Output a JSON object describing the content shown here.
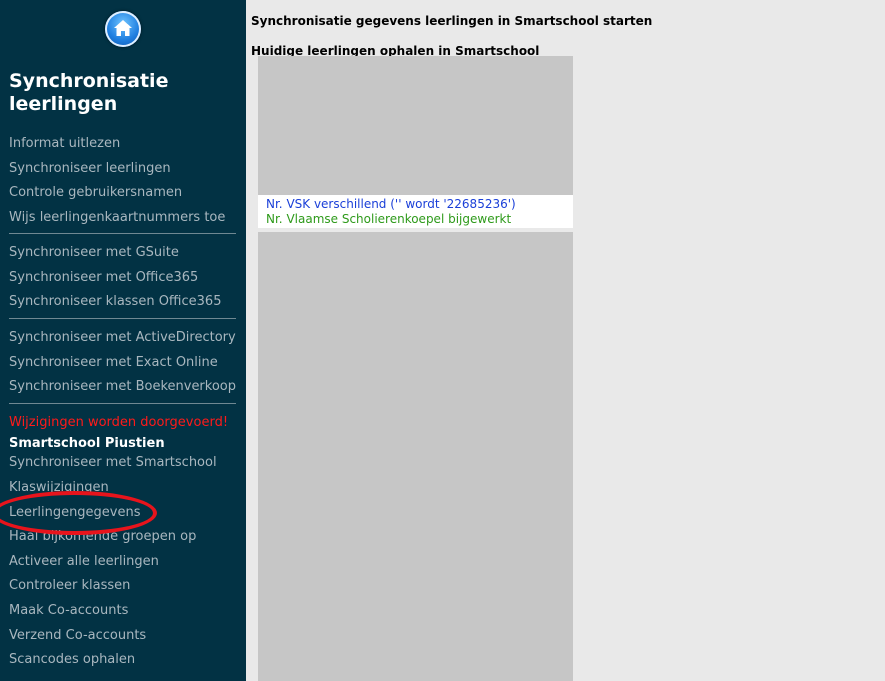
{
  "sidebar": {
    "title": "Synchronisatie leerlingen",
    "home_icon": "home-icon",
    "group1": [
      "Informat uitlezen",
      "Synchroniseer leerlingen",
      "Controle gebruikersnamen",
      "Wijs leerlingenkaartnummers toe"
    ],
    "group2": [
      "Synchroniseer met GSuite",
      "Synchroniseer met Office365",
      "Synchroniseer klassen Office365"
    ],
    "group3": [
      "Synchroniseer met ActiveDirectory",
      "Synchroniseer met Exact Online",
      "Synchroniseer met Boekenverkoop"
    ],
    "warning": "Wijzigingen worden doorgevoerd!",
    "section_heading": "Smartschool Piustien",
    "group4": [
      "Synchroniseer met Smartschool",
      "Klaswijzigingen",
      "Leerlingengegevens",
      "Haal bijkomende groepen op",
      "Activeer alle leerlingen",
      "Controleer klassen",
      "Maak Co-accounts",
      "Verzend Co-accounts",
      "Scancodes ophalen"
    ]
  },
  "main": {
    "title": "Synchronisatie gegevens leerlingen in Smartschool starten",
    "subtitle": "Huidige leerlingen ophalen in Smartschool",
    "log": [
      {
        "text": "Nr. VSK verschillend ('' wordt '22685236')",
        "color": "#1a3fd8"
      },
      {
        "text": "Nr. Vlaamse Scholierenkoepel bijgewerkt",
        "color": "#2e9a1a"
      }
    ]
  },
  "colors": {
    "sidebar_bg": "#023244",
    "warning": "#ff1a1a",
    "annotation_circle": "#e8141c"
  }
}
